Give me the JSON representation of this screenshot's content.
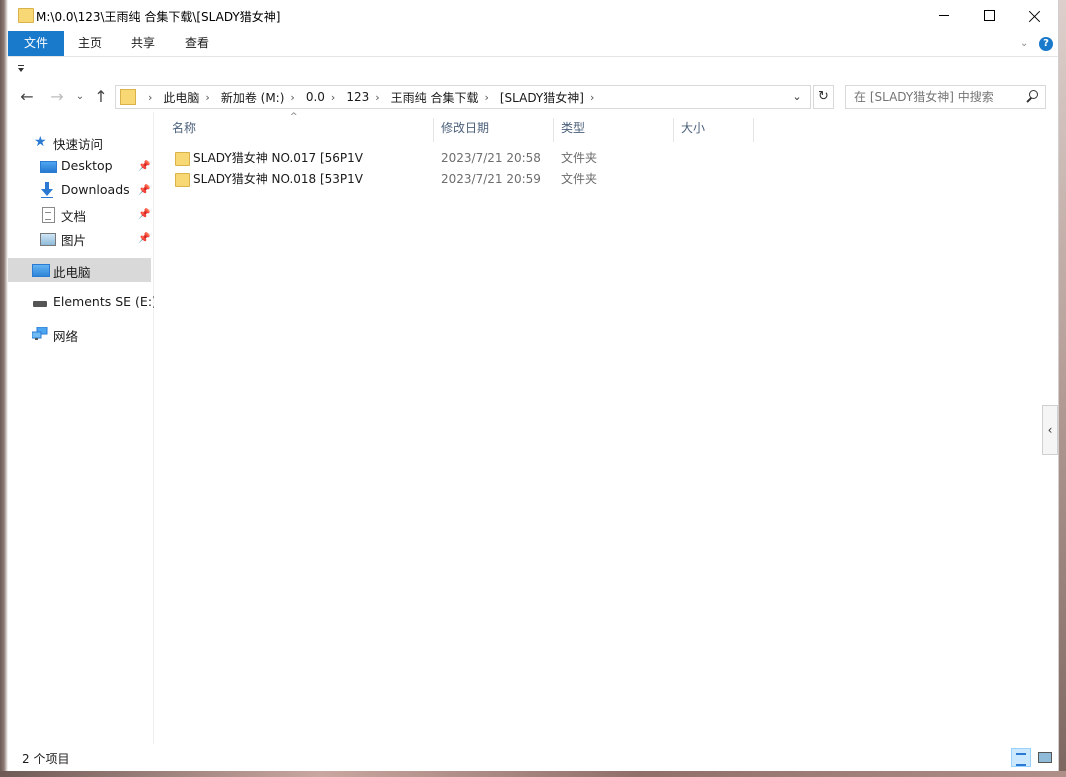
{
  "window": {
    "title": "M:\\0.0\\123\\王雨纯 合集下载\\[SLADY猎女神]"
  },
  "ribbon": {
    "tabs": [
      "文件",
      "主页",
      "共享",
      "查看"
    ],
    "help": "?"
  },
  "nav": {
    "back": "←",
    "forward": "→",
    "recent": "⌄",
    "up": "↑"
  },
  "address": {
    "crumbs": [
      "此电脑",
      "新加卷 (M:)",
      "0.0",
      "123",
      "王雨纯 合集下载",
      "[SLADY猎女神]"
    ],
    "separator": "›",
    "dropdown": "⌄",
    "refresh": "↻"
  },
  "search": {
    "placeholder": "在 [SLADY猎女神] 中搜索"
  },
  "sidebar": {
    "items": [
      {
        "label": "快速访问",
        "icon": "star-icon"
      },
      {
        "label": "Desktop",
        "icon": "desktop-icon",
        "pinned": true
      },
      {
        "label": "Downloads",
        "icon": "downloads-icon",
        "pinned": true
      },
      {
        "label": "文档",
        "icon": "document-icon",
        "pinned": true
      },
      {
        "label": "图片",
        "icon": "pictures-icon",
        "pinned": true
      },
      {
        "label": "此电脑",
        "icon": "this-pc-icon",
        "selected": true
      },
      {
        "label": "Elements SE (E:)",
        "icon": "drive-icon"
      },
      {
        "label": "网络",
        "icon": "network-icon"
      }
    ],
    "pin_glyph": "📌"
  },
  "columns": {
    "name": "名称",
    "date": "修改日期",
    "type": "类型",
    "size": "大小",
    "sort_glyph": "^"
  },
  "files": [
    {
      "name": "SLADY猎女神 NO.017 [56P1V",
      "date": "2023/7/21 20:58",
      "type": "文件夹"
    },
    {
      "name": "SLADY猎女神 NO.018 [53P1V",
      "date": "2023/7/21 20:59",
      "type": "文件夹"
    }
  ],
  "status": {
    "count_text": "2 个项目"
  },
  "side_collapse": "‹"
}
